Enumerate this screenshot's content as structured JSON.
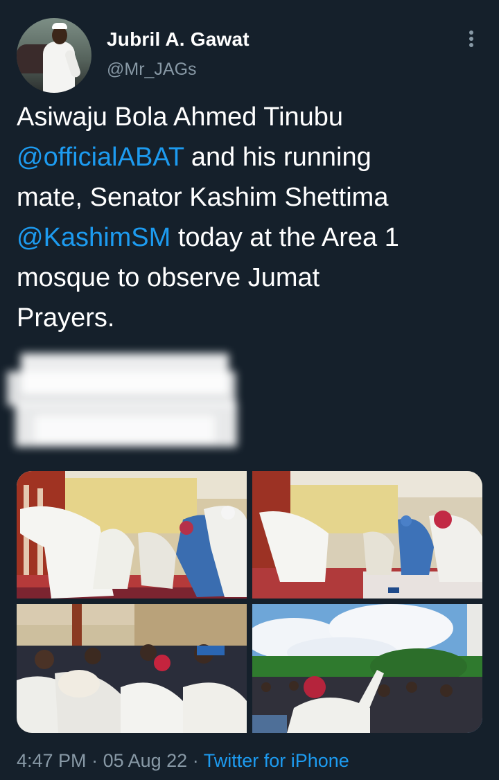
{
  "tweet": {
    "author": {
      "name": "Jubril A. Gawat",
      "handle": "@Mr_JAGs",
      "avatar_icon": "profile-photo"
    },
    "more_icon": "more-vertical-icon",
    "text": {
      "line1": "Asiwaju Bola Ahmed Tinubu",
      "mention1": "@officialABAT",
      "line2_rest": " and his running",
      "line3": "mate, Senator Kashim Shettima",
      "mention2": "@KashimSM",
      "line4_rest": " today at the Area 1",
      "line5": "mosque to observe Jumat",
      "line6": "Prayers."
    },
    "media": [
      {
        "id": 1,
        "description": "worshippers bowing in prayer"
      },
      {
        "id": 2,
        "description": "prayer line inside mosque"
      },
      {
        "id": 3,
        "description": "crowd inside mosque"
      },
      {
        "id": 4,
        "description": "crowd outside mosque waving"
      }
    ],
    "meta": {
      "time": "4:47 PM",
      "separator1": " · ",
      "date": "05 Aug 22",
      "separator2": " · ",
      "source": "Twitter for iPhone"
    },
    "colors": {
      "background": "#15202b",
      "text": "#ffffff",
      "secondary": "#8899a6",
      "link": "#1d9bf0"
    }
  }
}
